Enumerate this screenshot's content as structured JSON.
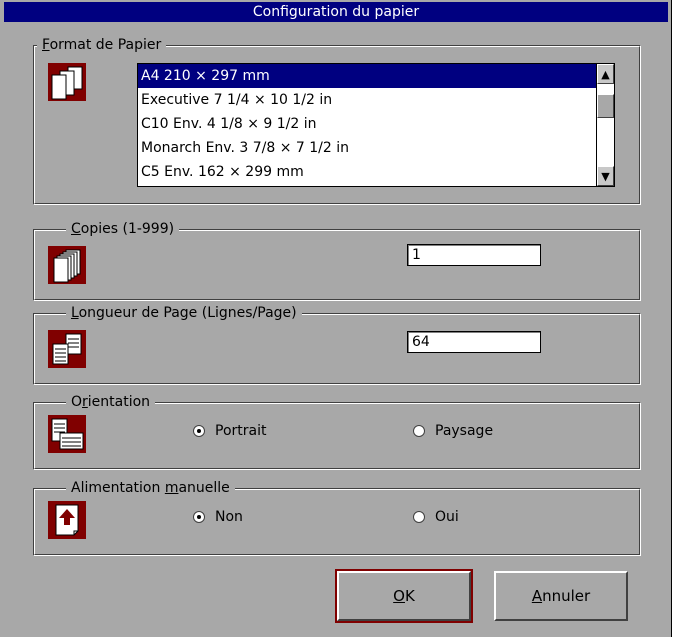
{
  "window": {
    "title": "Configuration du papier"
  },
  "paper_format": {
    "legend_first": "F",
    "legend_rest": "ormat de Papier",
    "icon": "paper-format-icon",
    "items": [
      "A4 210 × 297 mm",
      "Executive 7 1/4 × 10 1/2 in",
      "C10 Env. 4 1/8 × 9 1/2 in",
      "Monarch Env. 3 7/8 × 7 1/2 in",
      "C5 Env. 162 × 299 mm"
    ],
    "selected_index": 0
  },
  "copies": {
    "legend_first": "C",
    "legend_rest": "opies (1-999)",
    "icon": "copies-icon",
    "value": "1"
  },
  "page_length": {
    "legend_first": "L",
    "legend_rest": "ongueur de Page (Lignes/Page)",
    "icon": "page-length-icon",
    "value": "64"
  },
  "orientation": {
    "legend_pre": "O",
    "legend_u": "r",
    "legend_post": "ientation",
    "icon": "orientation-icon",
    "option_portrait": "Portrait",
    "option_landscape": "Paysage",
    "selected": "Portrait"
  },
  "manual_feed": {
    "legend_pre": "Alimentation ",
    "legend_u": "m",
    "legend_post": "anuelle",
    "icon": "manual-feed-icon",
    "option_no": "Non",
    "option_yes": "Oui",
    "selected": "Non"
  },
  "buttons": {
    "ok_u": "O",
    "ok_rest": "K",
    "cancel_u": "A",
    "cancel_rest": "nnuler"
  },
  "colors": {
    "title_bar": "#000080",
    "dialog_bg": "#a8a8a8",
    "icon_bg": "#800000",
    "selection": "#000080"
  }
}
